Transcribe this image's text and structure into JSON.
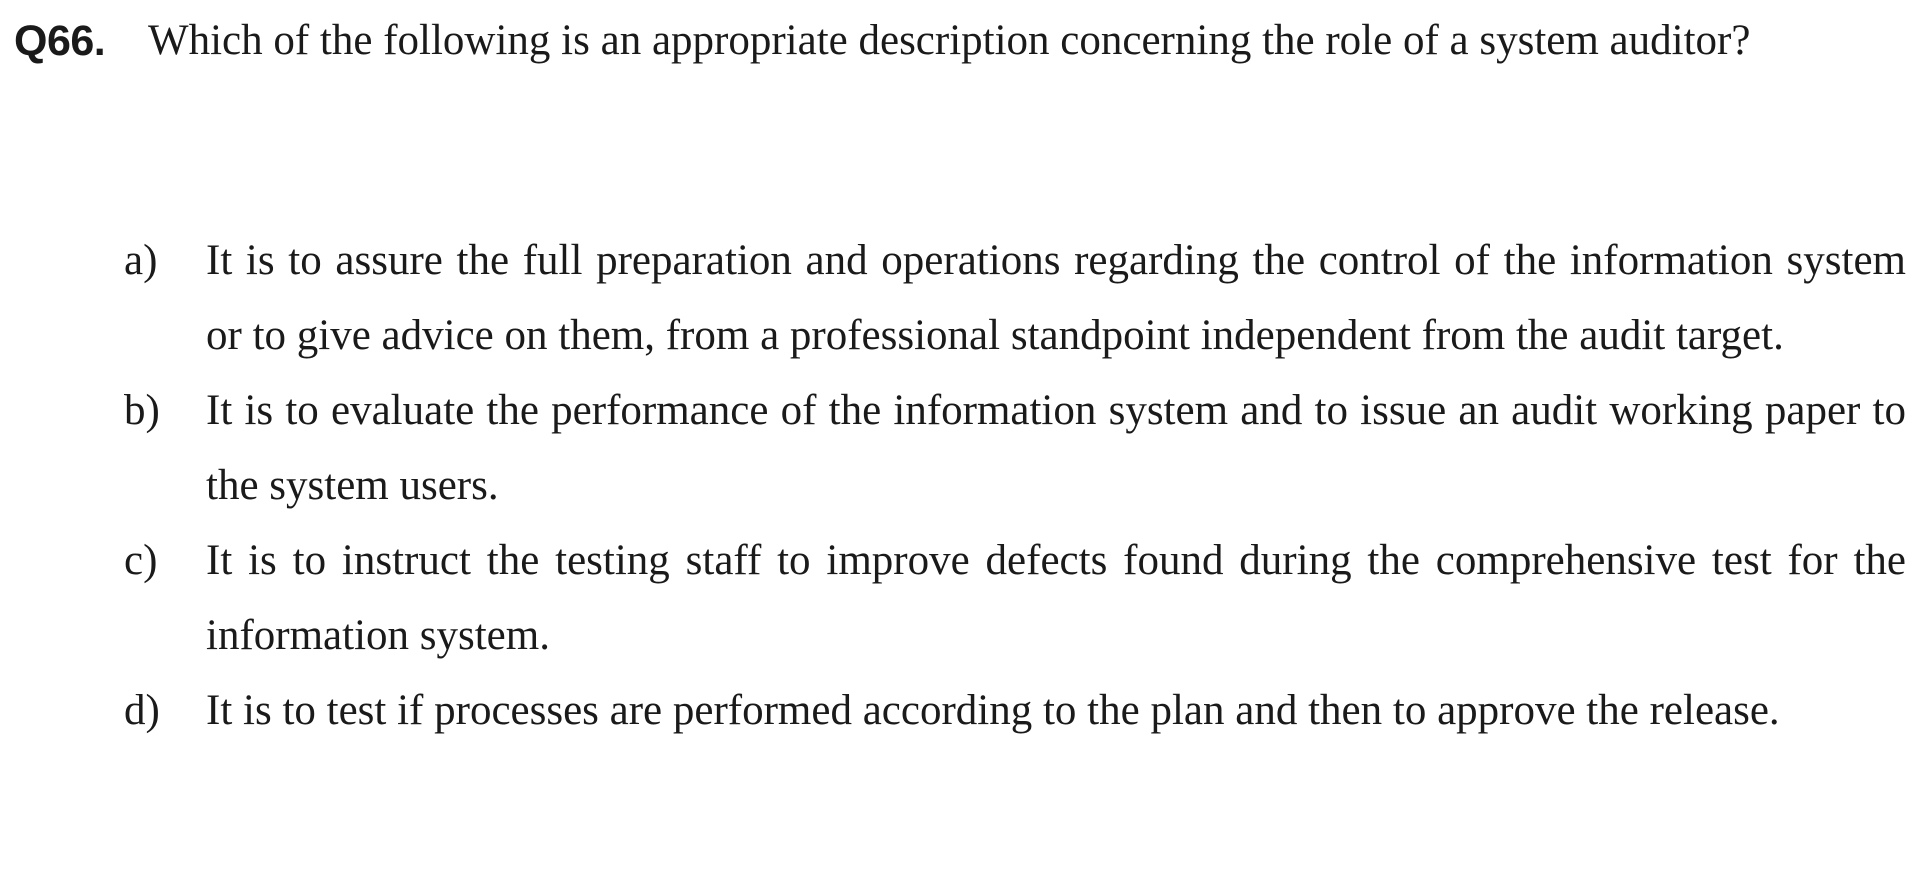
{
  "question": {
    "number": "Q66.",
    "text": "Which of the following is an appropriate description concerning the role of a system auditor?"
  },
  "options": [
    {
      "letter": "a)",
      "text": "It is to assure the full preparation and operations regarding the control of the information system or to give advice on them, from a professional standpoint independent from the audit target."
    },
    {
      "letter": "b)",
      "text": "It is to evaluate the performance of the information system and to issue an audit working paper to the system users."
    },
    {
      "letter": "c)",
      "text": "It is to instruct the testing staff to improve defects found during the comprehensive test for the information system."
    },
    {
      "letter": "d)",
      "text": "It is to test if processes are performed according to the plan and then to approve the release."
    }
  ]
}
